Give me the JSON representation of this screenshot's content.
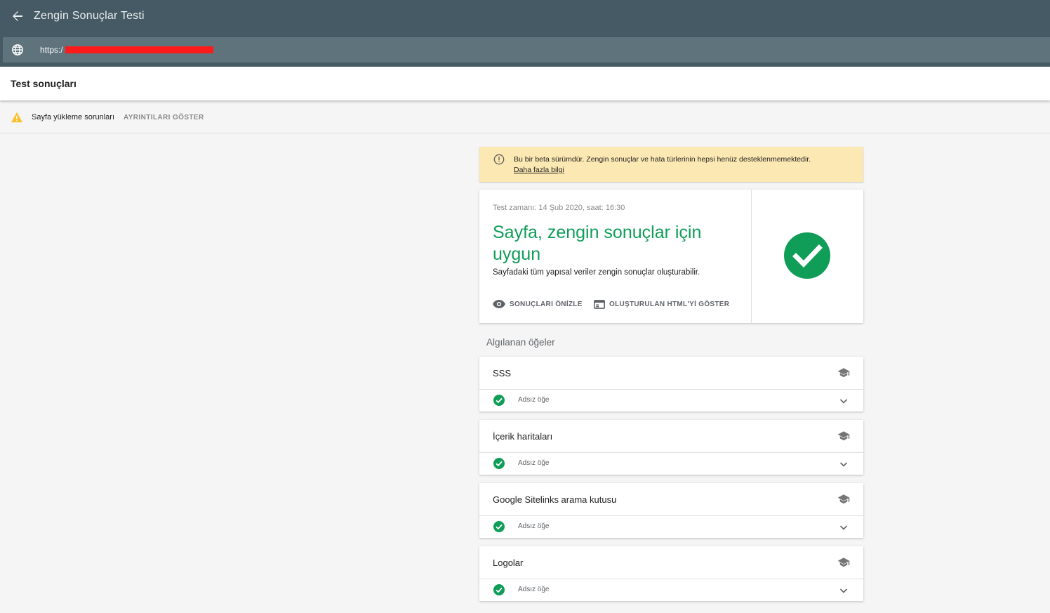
{
  "app": {
    "title": "Zengin Sonuçlar Testi"
  },
  "url_bar": {
    "value": "https:/"
  },
  "results_bar": {
    "title": "Test sonuçları"
  },
  "issues": {
    "text": "Sayfa yükleme sorunları",
    "details_label": "AYRINTILARI GÖSTER"
  },
  "beta_notice": {
    "text": "Bu bir beta sürümdür. Zengin sonuçlar ve hata türlerinin hepsi henüz desteklenmemektedir.",
    "link": "Daha fazla bilgi"
  },
  "result": {
    "test_time": "Test zamanı: 14 Şub 2020, saat: 16:30",
    "heading": "Sayfa, zengin sonuçlar için uygun",
    "subtext": "Sayfadaki tüm yapısal veriler zengin sonuçlar oluşturabilir.",
    "preview_label": "SONUÇLARI ÖNİZLE",
    "html_label": "OLUŞTURULAN HTML'Yİ GÖSTER",
    "status_color": "#0f9d58"
  },
  "detected": {
    "label": "Algılanan öğeler",
    "items": [
      {
        "title": "SSS",
        "row": "Adsız öğe"
      },
      {
        "title": "İçerik haritaları",
        "row": "Adsız öğe"
      },
      {
        "title": "Google Sitelinks arama kutusu",
        "row": "Adsız öğe"
      },
      {
        "title": "Logolar",
        "row": "Adsız öğe"
      }
    ]
  },
  "colors": {
    "header": "#455a64",
    "url_bar": "#5f737d",
    "success": "#0f9d58",
    "warning": "#fbc02d",
    "beta_bg": "#fce8b2"
  }
}
